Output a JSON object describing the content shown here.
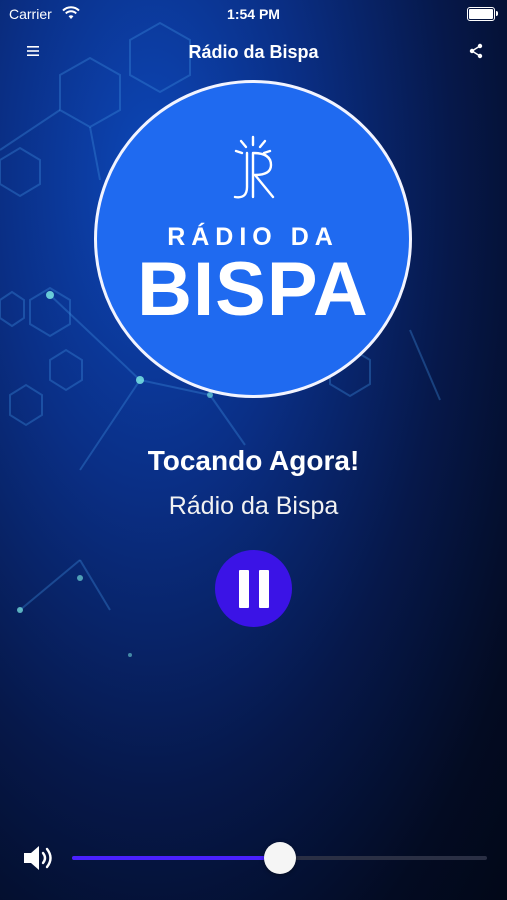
{
  "status_bar": {
    "carrier": "Carrier",
    "time": "1:54 PM"
  },
  "nav": {
    "title": "Rádio da Bispa",
    "menu_icon": "hamburger-icon",
    "share_icon": "share-icon"
  },
  "logo": {
    "monogram": "JR",
    "line1": "RÁDIO DA",
    "line2": "BISPA",
    "background": "#1f6af0"
  },
  "player": {
    "heading": "Tocando Agora!",
    "station": "Rádio da Bispa",
    "state": "playing",
    "button_color": "#3b13e6"
  },
  "volume": {
    "level": 0.5,
    "icon": "speaker-volume-icon",
    "accent": "#4a21ff"
  }
}
